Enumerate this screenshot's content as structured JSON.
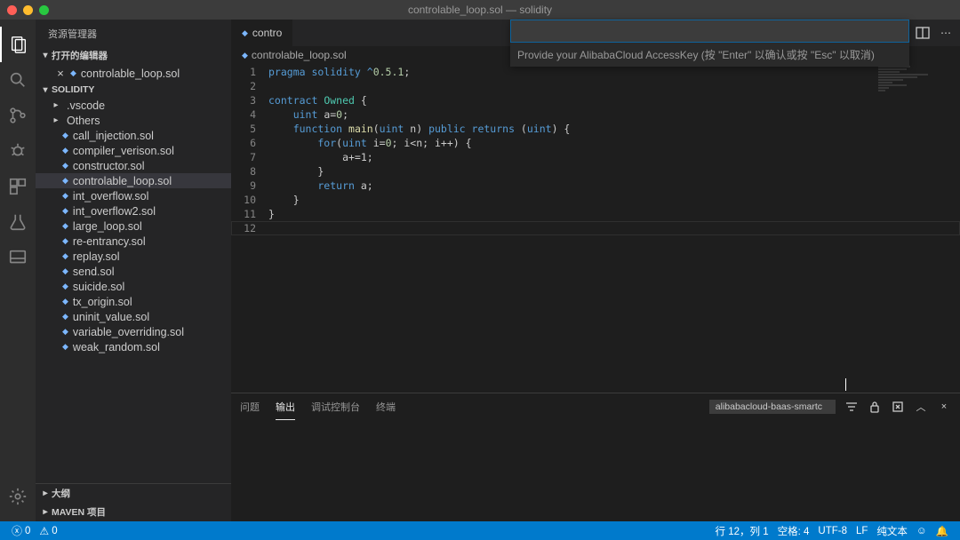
{
  "title": "controlable_loop.sol — solidity",
  "sidebar": {
    "title": "资源管理器",
    "open_editors_label": "打开的编辑器",
    "open_file": "controlable_loop.sol",
    "project_name": "SOLIDITY",
    "folders": [
      {
        "name": ".vscode",
        "expanded": false
      },
      {
        "name": "Others",
        "expanded": false
      }
    ],
    "files": [
      "call_injection.sol",
      "compiler_verison.sol",
      "constructor.sol",
      "controlable_loop.sol",
      "int_overflow.sol",
      "int_overflow2.sol",
      "large_loop.sol",
      "re-entrancy.sol",
      "replay.sol",
      "send.sol",
      "suicide.sol",
      "tx_origin.sol",
      "uninit_value.sol",
      "variable_overriding.sol",
      "weak_random.sol"
    ],
    "active_file_index": 3,
    "outline_label": "大纲",
    "maven_label": "MAVEN 项目"
  },
  "tabs": {
    "active": "controlable_loop.sol",
    "bg": "contro"
  },
  "prompt": {
    "placeholder": "",
    "hint": "Provide your AlibabaCloud AccessKey (按 \"Enter\" 以确认或按 \"Esc\" 以取消)"
  },
  "breadcrumb": {
    "file": "controlable_loop.sol"
  },
  "code": {
    "lines": [
      "1",
      "2",
      "3",
      "4",
      "5",
      "6",
      "7",
      "8",
      "9",
      "10",
      "11",
      "12"
    ],
    "l1_a": "pragma solidity ^",
    "l1_b": "0.5.1",
    "l1_c": ";",
    "l3_a": "contract",
    "l3_b": " Owned ",
    "l3_c": "{",
    "l4_a": "    uint",
    "l4_b": " a=",
    "l4_c": "0",
    "l4_d": ";",
    "l5_a": "    function",
    "l5_b": " main",
    "l5_c": "(",
    "l5_d": "uint",
    "l5_e": " n) ",
    "l5_f": "public",
    "l5_g": " returns",
    "l5_h": " (",
    "l5_i": "uint",
    "l5_j": ") {",
    "l6_a": "        for",
    "l6_b": "(",
    "l6_c": "uint",
    "l6_d": " i=",
    "l6_e": "0",
    "l6_f": "; i<n; i++) {",
    "l7": "            a+=1;",
    "l8": "        }",
    "l9_a": "        return",
    "l9_b": " a;",
    "l10": "    }",
    "l11": "}"
  },
  "panel": {
    "tabs": [
      "问题",
      "输出",
      "调试控制台",
      "终端"
    ],
    "active_tab": 1,
    "dropdown": "alibabacloud-baas-smartc"
  },
  "statusbar": {
    "errors": "0",
    "warnings": "0",
    "ln_col": "行 12，列 1",
    "spaces": "空格: 4",
    "encoding": "UTF-8",
    "eol": "LF",
    "lang": "纯文本"
  }
}
